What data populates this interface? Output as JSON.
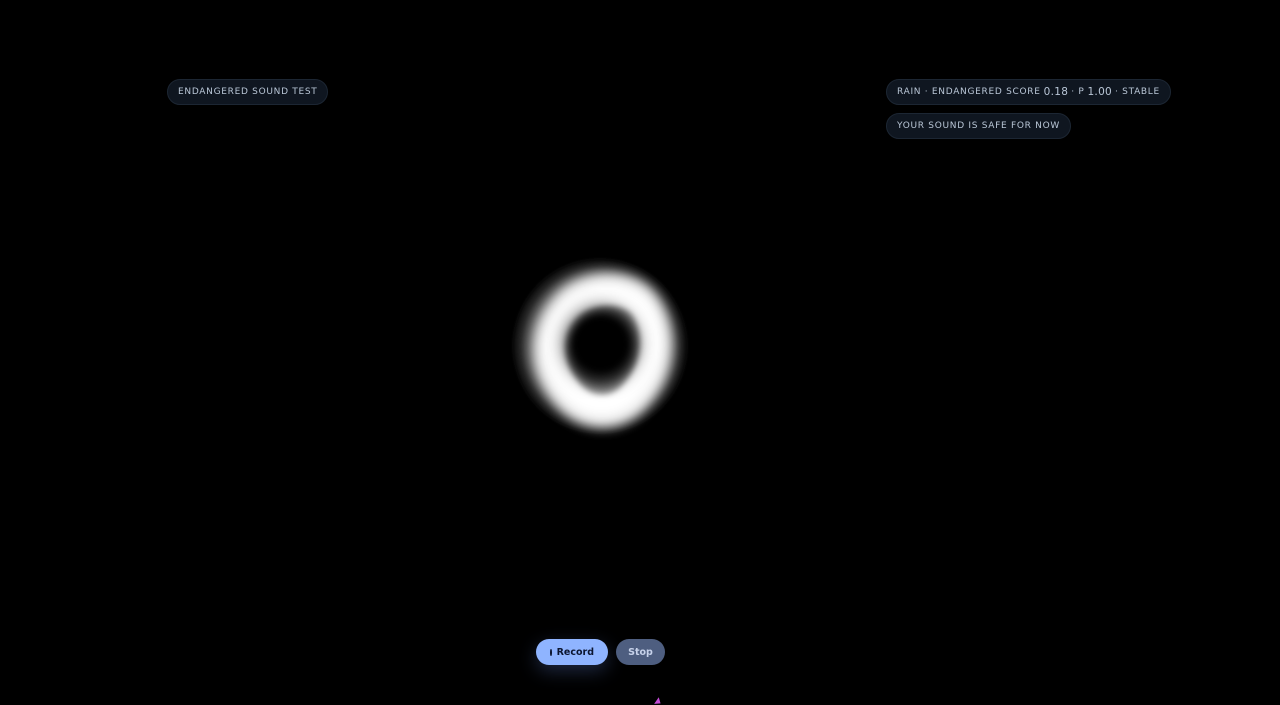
{
  "header": {
    "title": "Endangered sound test"
  },
  "status": {
    "label": "Rain · endangered score",
    "score": "0.18",
    "p_label": "· p",
    "p_value": "1.00",
    "trend": "· stable"
  },
  "message": {
    "text": "Your sound is safe for now"
  },
  "controls": {
    "record_label": "Record",
    "stop_label": "Stop"
  },
  "colors": {
    "background": "#000000",
    "pill_bg": "#0f1620",
    "record_accent": "#8fb4ff",
    "stop_bg": "#4e5e80"
  },
  "icons": {
    "record": "record-dot-icon",
    "visualizer": "sound-orb-icon"
  }
}
